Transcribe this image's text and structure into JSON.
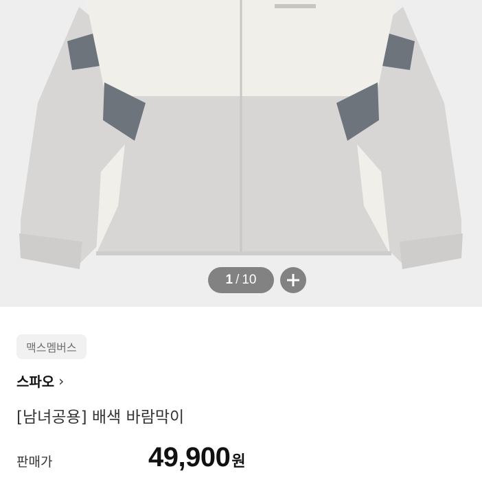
{
  "gallery": {
    "current": "1",
    "separator": "/",
    "total": "10",
    "background": "#eeeeee"
  },
  "product": {
    "badge": "맥스멤버스",
    "brand": "스파오",
    "brand_chevron": "›",
    "title": "[남녀공용] 배색 바람막이",
    "price_label": "판매가",
    "price": "49,900",
    "price_unit": "원"
  },
  "colors": {
    "jacket_light": "#d8d6d5",
    "jacket_cream": "#f1efea",
    "jacket_accent": "#6d747c"
  },
  "icons": {
    "zoom": "plus-icon"
  }
}
